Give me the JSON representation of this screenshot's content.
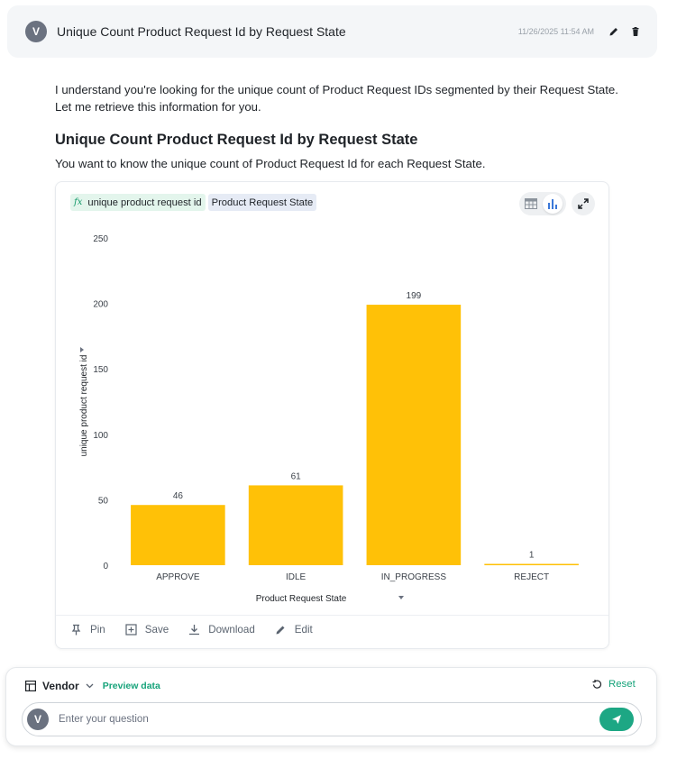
{
  "query": {
    "avatar_initial": "V",
    "text": "Unique Count Product Request Id by Request State",
    "timestamp": "11/26/2025 11:54 AM",
    "edit_icon": "pencil-icon",
    "delete_icon": "trash-icon"
  },
  "answer": {
    "intro": "I understand you're looking for the unique count of Product Request IDs segmented by their Request State. Let me retrieve this information for you.",
    "title": "Unique Count Product Request Id by Request State",
    "subtitle": "You want to know the unique count of Product Request Id for each Request State."
  },
  "card": {
    "measure_chip": {
      "prefix": "fx",
      "label": "unique product request id"
    },
    "dimension_chip": {
      "label": "Product Request  State"
    },
    "actions": [
      {
        "label": "Pin",
        "icon": "pin-icon"
      },
      {
        "label": "Save",
        "icon": "save-icon"
      },
      {
        "label": "Download",
        "icon": "download-icon"
      },
      {
        "label": "Edit",
        "icon": "pencil-icon"
      }
    ]
  },
  "chart_data": {
    "type": "bar",
    "categories": [
      "APPROVE",
      "IDLE",
      "IN_PROGRESS",
      "REJECT"
    ],
    "values": [
      46,
      61,
      199,
      1
    ],
    "title": "",
    "xlabel": "Product Request State",
    "ylabel": "unique product request id",
    "ylim": [
      0,
      250
    ],
    "yticks": [
      0,
      50,
      100,
      150,
      200,
      250
    ],
    "grid": false,
    "data_labels": true,
    "bar_color": "#FFC107"
  },
  "composer": {
    "datasource": "Vendor",
    "preview_label": "Preview data",
    "reset_label": "Reset",
    "avatar_initial": "V",
    "placeholder": "Enter your question"
  },
  "colors": {
    "accent": "#1DA784",
    "bar": "#FFC107",
    "avatar": "#6B7280"
  }
}
